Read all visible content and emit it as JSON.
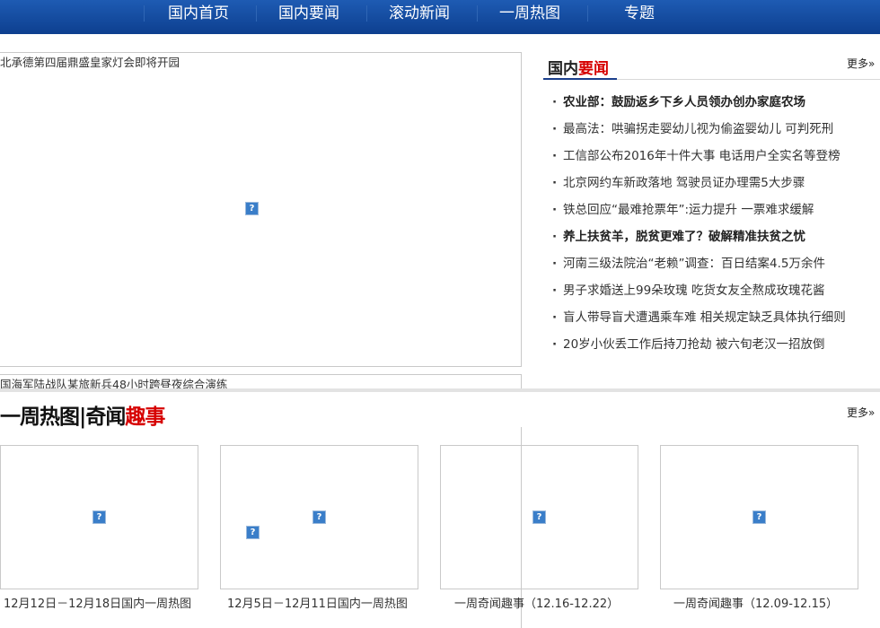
{
  "nav": {
    "items": [
      "国内首页",
      "国内要闻",
      "滚动新闻",
      "一周热图",
      "专题"
    ]
  },
  "feature": {
    "caption": "北承德第四届鼎盛皇家灯会即将开园",
    "second_caption": "国海军陆战队某旅新兵48小时跨昼夜综合演练",
    "image_icon": "broken-image-icon"
  },
  "news_panel": {
    "title_black": "国内",
    "title_red": "要闻",
    "more": "更多»",
    "items": [
      {
        "text": "农业部：鼓励返乡下乡人员领办创办家庭农场",
        "bold": true
      },
      {
        "text": "最高法：哄骗拐走婴幼儿视为偷盗婴幼儿 可判死刑",
        "bold": false
      },
      {
        "text": "工信部公布2016年十件大事 电话用户全实名等登榜",
        "bold": false
      },
      {
        "text": "北京网约车新政落地 驾驶员证办理需5大步骤",
        "bold": false
      },
      {
        "text": "铁总回应“最难抢票年”:运力提升 一票难求缓解",
        "bold": false
      },
      {
        "text": "养上扶贫羊，脱贫更难了？破解精准扶贫之忧",
        "bold": true
      },
      {
        "text": "河南三级法院治“老赖”调查：百日结案4.5万余件",
        "bold": false
      },
      {
        "text": "男子求婚送上99朵玫瑰 吃货女友全熬成玫瑰花酱",
        "bold": false
      },
      {
        "text": "盲人带导盲犬遭遇乘车难 相关规定缺乏具体执行细则",
        "bold": false
      },
      {
        "text": "20岁小伙丢工作后持刀抢劫 被六旬老汉一招放倒",
        "bold": false
      }
    ]
  },
  "week_section": {
    "title_black": "一周热图|奇闻",
    "title_red": "趣事",
    "more": "更多»",
    "thumbs": [
      {
        "caption": "12月12日－12月18日国内一周热图"
      },
      {
        "caption": "12月5日－12月11日国内一周热图"
      },
      {
        "caption": "一周奇闻趣事（12.16-12.22）"
      },
      {
        "caption": "一周奇闻趣事（12.09-12.15）"
      }
    ]
  },
  "colors": {
    "nav_bg": "#1e5bb3",
    "accent_red": "#d60000",
    "panel_underline": "#1b3f8c"
  }
}
